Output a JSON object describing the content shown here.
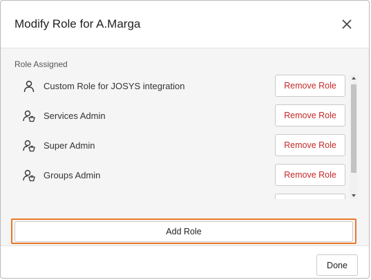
{
  "dialog": {
    "title": "Modify Role for A.Marga",
    "close_icon": "close-icon"
  },
  "roles": {
    "section_label": "Role Assigned",
    "items": [
      {
        "name": "Custom Role for JOSYS integration",
        "icon": "user-icon",
        "remove_label": "Remove Role"
      },
      {
        "name": "Services Admin",
        "icon": "user-admin-icon",
        "remove_label": "Remove Role"
      },
      {
        "name": "Super Admin",
        "icon": "user-admin-icon",
        "remove_label": "Remove Role"
      },
      {
        "name": "Groups Admin",
        "icon": "user-admin-icon",
        "remove_label": "Remove Role"
      }
    ]
  },
  "actions": {
    "add_role_label": "Add Role",
    "done_label": "Done"
  },
  "colors": {
    "remove_text": "#c62828",
    "highlight_border": "#e8782a"
  }
}
